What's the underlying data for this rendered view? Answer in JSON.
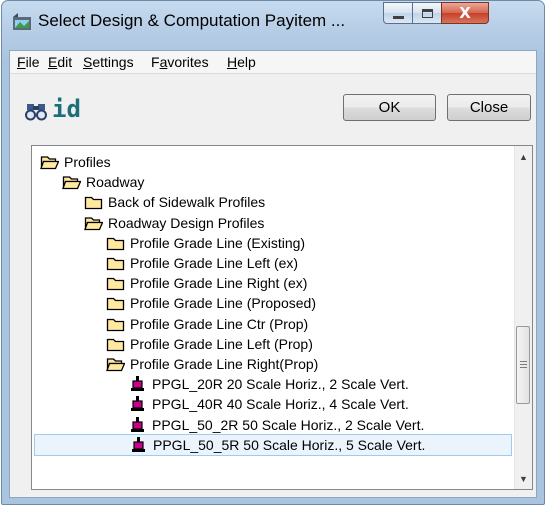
{
  "window": {
    "title": "Select Design & Computation Payitem ...",
    "close_glyph": "X"
  },
  "menu": [
    {
      "accel": "F",
      "rest": "ile"
    },
    {
      "accel": "E",
      "rest": "dit"
    },
    {
      "accel": "S",
      "rest": "ettings"
    },
    {
      "pre": "F",
      "accel": "a",
      "rest": "vorites"
    },
    {
      "accel": "H",
      "rest": "elp"
    }
  ],
  "toolbar": {
    "find_icon": "binoculars-icon",
    "id_label": "id",
    "ok_label": "OK",
    "close_label": "Close"
  },
  "tree": {
    "items": [
      {
        "label": "Profiles",
        "icon": "open-folder-icon"
      },
      {
        "label": "Roadway",
        "icon": "open-folder-icon"
      },
      {
        "label": "Back of Sidewalk Profiles",
        "icon": "folder-icon"
      },
      {
        "label": "Roadway Design Profiles",
        "icon": "open-folder-icon"
      },
      {
        "label": "Profile Grade Line (Existing)",
        "icon": "folder-icon"
      },
      {
        "label": "Profile Grade Line Left (ex)",
        "icon": "folder-icon"
      },
      {
        "label": "Profile Grade Line Right (ex)",
        "icon": "folder-icon"
      },
      {
        "label": "Profile Grade Line (Proposed)",
        "icon": "folder-icon"
      },
      {
        "label": "Profile Grade Line Ctr (Prop)",
        "icon": "folder-icon"
      },
      {
        "label": "Profile Grade Line Left (Prop)",
        "icon": "folder-icon"
      },
      {
        "label": "Profile Grade Line Right(Prop)",
        "icon": "open-folder-icon"
      },
      {
        "label": "PPGL_20R 20 Scale Horiz., 2 Scale Vert.",
        "icon": "payitem-icon"
      },
      {
        "label": "PPGL_40R 40 Scale Horiz., 4 Scale Vert.",
        "icon": "payitem-icon"
      },
      {
        "label": "PPGL_50_2R 50 Scale Horiz., 2 Scale Vert.",
        "icon": "payitem-icon"
      },
      {
        "label": "PPGL_50_5R 50 Scale Horiz., 5 Scale Vert.",
        "icon": "payitem-icon",
        "selected": true
      }
    ]
  },
  "colors": {
    "folder_fill": "#ffe9a0",
    "folder_stroke": "#000000",
    "payitem_accent": "#c8008c",
    "id_text": "#1a6f78",
    "selection_bg": "#ebf4fd"
  }
}
